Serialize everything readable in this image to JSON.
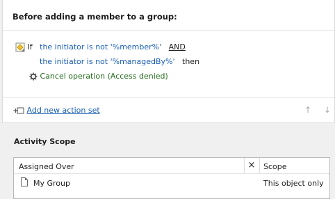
{
  "header": {
    "title": "Before adding a member to a group:"
  },
  "condition": {
    "if_label": "If",
    "line1_text": "the initiator is not '%member%'",
    "and_label": "AND",
    "line2_text": "the initiator is not '%managedBy%'",
    "then_label": "then"
  },
  "action": {
    "label": "Cancel operation (Access denied)"
  },
  "action_set": {
    "add_label": "Add new action set",
    "up_arrow": "↑",
    "down_arrow": "↓"
  },
  "activity_scope": {
    "title": "Activity Scope",
    "columns": {
      "assigned_over": "Assigned Over",
      "remove": "×",
      "scope": "Scope"
    },
    "rows": [
      {
        "assigned_over": "My Group",
        "scope": "This object only"
      }
    ]
  },
  "colors": {
    "link": "#1a5fb4",
    "action": "#256e1e",
    "warning_icon": "#e6a817"
  }
}
